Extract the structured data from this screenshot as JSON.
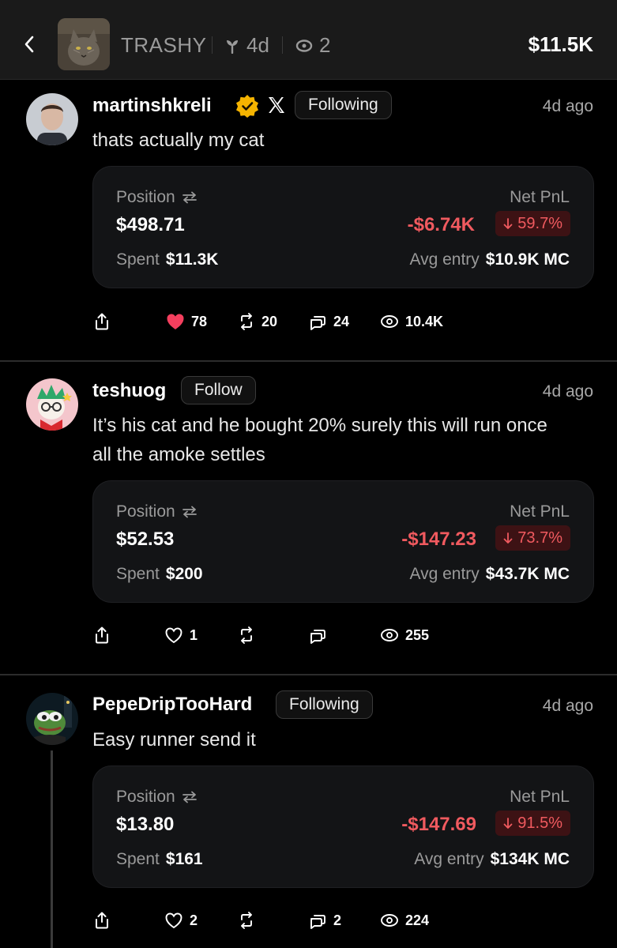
{
  "header": {
    "token_name": "TRASHY",
    "age": "4d",
    "watchers": "2",
    "market_cap": "$11.5K"
  },
  "colors": {
    "negative": "#f05a5f",
    "badge_bg": "#3d1214",
    "card_bg": "#131416",
    "verified": "#f5b400",
    "like": "#f43f5e"
  },
  "labels": {
    "position": "Position",
    "net_pnl": "Net PnL",
    "spent": "Spent",
    "avg_entry": "Avg entry"
  },
  "posts": [
    {
      "username": "martinshkreli",
      "verified": true,
      "platform_icon": "x-logo-icon",
      "follow_label": "Following",
      "time": "4d ago",
      "text": "thats actually my cat",
      "position": "$498.71",
      "pnl": "-$6.74K",
      "pnl_pct": "59.7%",
      "spent": "$11.3K",
      "avg_entry": "$10.9K MC",
      "likes": "78",
      "liked": true,
      "reposts": "20",
      "replies": "24",
      "views": "10.4K"
    },
    {
      "username": "teshuog",
      "verified": false,
      "follow_label": "Follow",
      "time": "4d ago",
      "text": "It’s his cat and he bought 20% surely this will run once all the amoke settles",
      "position": "$52.53",
      "pnl": "-$147.23",
      "pnl_pct": "73.7%",
      "spent": "$200",
      "avg_entry": "$43.7K MC",
      "likes": "1",
      "liked": false,
      "reposts": "",
      "replies": "",
      "views": "255"
    },
    {
      "username": "PepeDripTooHard",
      "verified": false,
      "follow_label": "Following",
      "time": "4d ago",
      "text": "Easy runner send it",
      "position": "$13.80",
      "pnl": "-$147.69",
      "pnl_pct": "91.5%",
      "spent": "$161",
      "avg_entry": "$134K MC",
      "likes": "2",
      "liked": false,
      "reposts": "",
      "replies": "2",
      "views": "224"
    }
  ]
}
